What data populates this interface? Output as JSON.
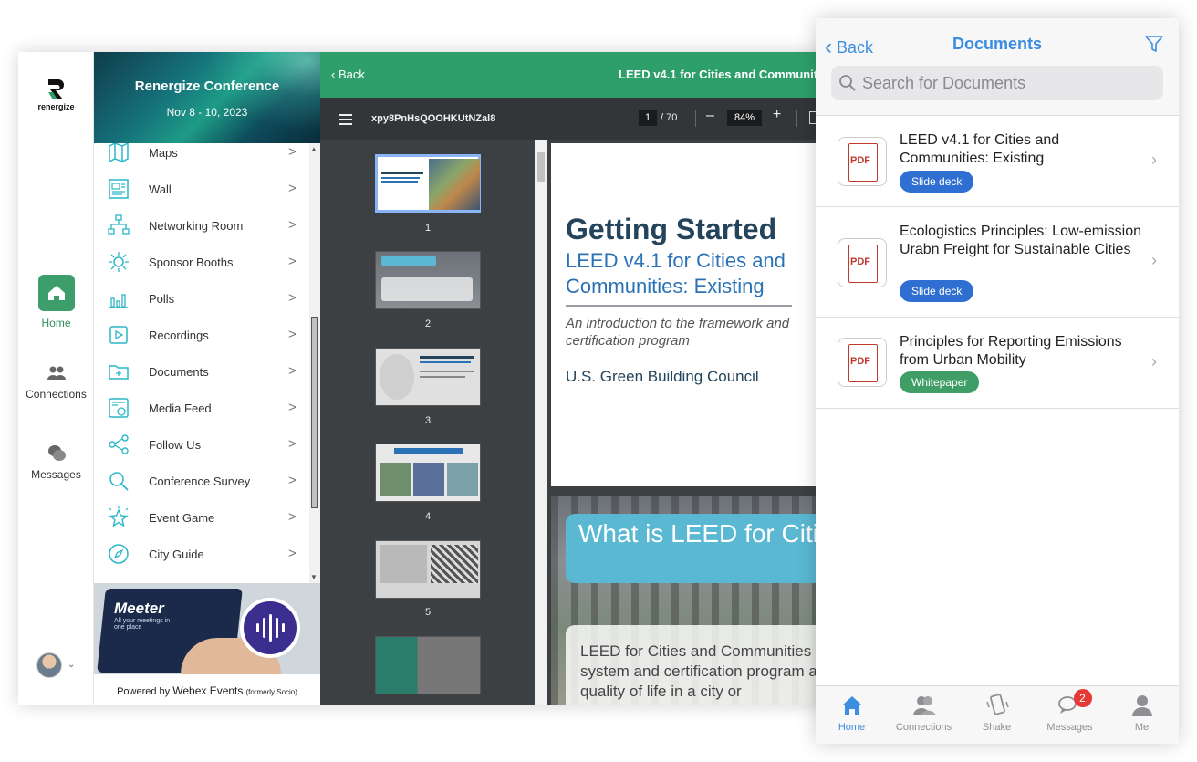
{
  "web": {
    "brand": {
      "name": "renergize"
    },
    "rail": {
      "items": [
        {
          "label": "Home",
          "icon": "home-icon",
          "active": true
        },
        {
          "label": "Connections",
          "icon": "people-icon"
        },
        {
          "label": "Messages",
          "icon": "chat-bubbles-icon"
        }
      ]
    },
    "event": {
      "title": "Renergize Conference",
      "dates": "Nov 8 - 10, 2023"
    },
    "menu": {
      "items": [
        {
          "label": "Maps",
          "icon": "map-icon"
        },
        {
          "label": "Wall",
          "icon": "wall-icon"
        },
        {
          "label": "Networking Room",
          "icon": "network-icon"
        },
        {
          "label": "Sponsor Booths",
          "icon": "sponsor-icon"
        },
        {
          "label": "Polls",
          "icon": "poll-icon"
        },
        {
          "label": "Recordings",
          "icon": "play-icon"
        },
        {
          "label": "Documents",
          "icon": "folder-icon"
        },
        {
          "label": "Media Feed",
          "icon": "news-icon"
        },
        {
          "label": "Follow Us",
          "icon": "share-icon"
        },
        {
          "label": "Conference Survey",
          "icon": "search-icon"
        },
        {
          "label": "Event Game",
          "icon": "star-icon"
        },
        {
          "label": "City Guide",
          "icon": "compass-icon"
        }
      ],
      "chevron": ">"
    },
    "promo": {
      "brand": "Meeter",
      "tagline": "All your meetings in one place"
    },
    "powered_by": {
      "prefix": "Powered by",
      "brand": "Webex Events",
      "suffix": "(formerly Socio)"
    },
    "viewer": {
      "back_label": "Back",
      "title": "LEED v4.1 for Cities and Communiti",
      "file_name": "xpy8PnHsQOOHKUtNZal8",
      "current_page": "1",
      "total_pages": "/ 70",
      "zoom": "84%",
      "thumbnails": [
        "1",
        "2",
        "3",
        "4",
        "5"
      ],
      "slide1": {
        "title": "Getting Started",
        "subtitle": "LEED v4.1 for Cities and Communities: Existing",
        "intro": "An introduction to the framework and certification program",
        "org": "U.S. Green Building Council"
      },
      "slide2": {
        "title": "What is LEED for Cities and Communities",
        "body": "LEED for Cities and Communities system and certification program and quality of life in a city or"
      }
    }
  },
  "mobile": {
    "back_label": "Back",
    "title": "Documents",
    "search_placeholder": "Search for Documents",
    "documents": [
      {
        "title": "LEED v4.1 for Cities and Communities: Existing",
        "tag": "Slide deck",
        "tag_color": "#2f6fd1",
        "icon_text": "PDF"
      },
      {
        "title": "Ecologistics Principles: Low-emission Urabn Freight for Sustainable Cities",
        "tag": "Slide deck",
        "tag_color": "#2f6fd1",
        "icon_text": "PDF"
      },
      {
        "title": "Principles for Reporting Emissions from Urban Mobility",
        "tag": "Whitepaper",
        "tag_color": "#3f9d66",
        "icon_text": "PDF"
      }
    ],
    "tabs": [
      {
        "label": "Home",
        "icon": "home-icon",
        "active": true
      },
      {
        "label": "Connections",
        "icon": "people-icon"
      },
      {
        "label": "Shake",
        "icon": "phone-shake-icon"
      },
      {
        "label": "Messages",
        "icon": "chat-bubbles-icon",
        "badge": "2"
      },
      {
        "label": "Me",
        "icon": "person-icon"
      }
    ]
  },
  "colors": {
    "accent_green": "#2e9f6b",
    "ios_blue": "#3b8de0",
    "menu_icon": "#2bb7c9"
  }
}
